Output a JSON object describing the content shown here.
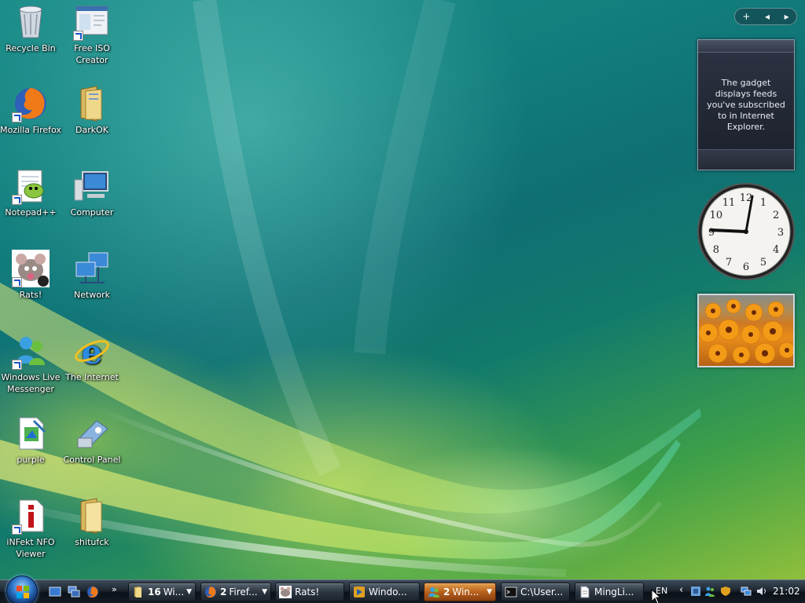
{
  "desktop": {
    "icons": [
      {
        "label": "Recycle Bin",
        "icon": "recycle-bin-icon"
      },
      {
        "label": "Free ISO Creator",
        "icon": "iso-creator-icon"
      },
      {
        "label": "Mozilla Firefox",
        "icon": "firefox-icon"
      },
      {
        "label": "DarkOK",
        "icon": "folder-icon"
      },
      {
        "label": "Notepad++",
        "icon": "notepadpp-icon"
      },
      {
        "label": "Computer",
        "icon": "computer-icon"
      },
      {
        "label": "Rats!",
        "icon": "rats-icon"
      },
      {
        "label": "Network",
        "icon": "network-icon"
      },
      {
        "label": "Windows Live Messenger",
        "icon": "messenger-icon"
      },
      {
        "label": "The Internet",
        "icon": "internet-explorer-icon"
      },
      {
        "label": "purple",
        "icon": "document-icon"
      },
      {
        "label": "Control Panel",
        "icon": "control-panel-icon"
      },
      {
        "label": "iNFekt NFO Viewer",
        "icon": "nfo-viewer-icon"
      },
      {
        "label": "shitufck",
        "icon": "folder-icon"
      }
    ]
  },
  "sidebar": {
    "controls": {
      "add": "+",
      "prev": "◂",
      "next": "▸"
    },
    "feed_gadget": {
      "message": "The gadget displays feeds you've subscribed to in Internet Explorer."
    },
    "clock": {
      "numerals": [
        "12",
        "1",
        "2",
        "3",
        "4",
        "5",
        "6",
        "7",
        "8",
        "9",
        "10",
        "11"
      ]
    }
  },
  "taskbar": {
    "overflow": "»",
    "buttons": [
      {
        "count": "16",
        "label": "Wi...",
        "icon": "folder-icon",
        "group": true
      },
      {
        "count": "2",
        "label": "Firef...",
        "icon": "firefox-icon",
        "group": true
      },
      {
        "count": "",
        "label": "Rats!",
        "icon": "rats-icon",
        "group": false
      },
      {
        "count": "",
        "label": "Windo...",
        "icon": "media-player-icon",
        "group": false
      },
      {
        "count": "2",
        "label": "Win...",
        "icon": "messenger-icon",
        "group": true,
        "active": true
      },
      {
        "count": "",
        "label": "C:\\User...",
        "icon": "console-icon",
        "group": false
      },
      {
        "count": "",
        "label": "MingLi...",
        "icon": "document-icon",
        "group": false
      }
    ],
    "tray": {
      "language": "EN",
      "expand": "‹",
      "time": "21:02"
    }
  }
}
